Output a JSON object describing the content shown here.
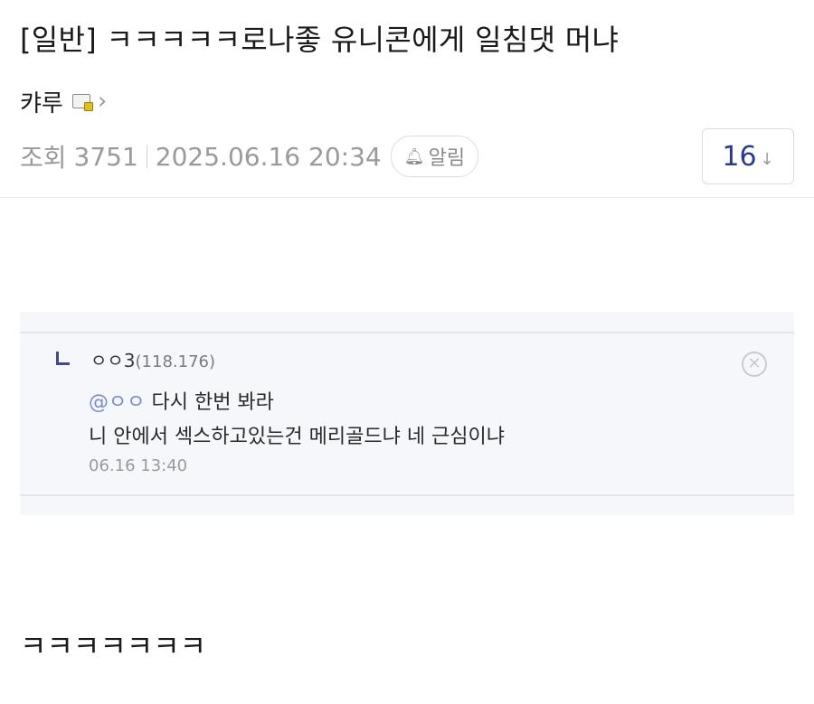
{
  "post": {
    "title": "[일반] ㅋㅋㅋㅋㅋ로나좋 유니콘에게 일침댓 머냐",
    "author": "캬루",
    "views_label": "조회",
    "views": "3751",
    "datetime": "2025.06.16 20:34",
    "alarm_label": "알림",
    "comment_count": "16",
    "body_text": "ㅋㅋㅋㅋㅋㅋㅋ"
  },
  "icons": {
    "member": "member-badge-icon",
    "chevron": "chevron-right-icon",
    "bell": "bell-icon",
    "down_arrow": "down-arrow-icon",
    "close": "close-icon"
  },
  "captured_comment": {
    "user": "ㅇㅇ3",
    "ip": "(118.176)",
    "mention": "@ㅇㅇ",
    "line1_rest": " 다시 한번 봐라",
    "line2": "니 안에서 섹스하고있는건 메리골드냐 네 근심이냐",
    "time": "06.16 13:40"
  },
  "colors": {
    "accent": "#2b3a8c",
    "mention": "#7a8ad0",
    "muted": "#9a9a9a"
  }
}
